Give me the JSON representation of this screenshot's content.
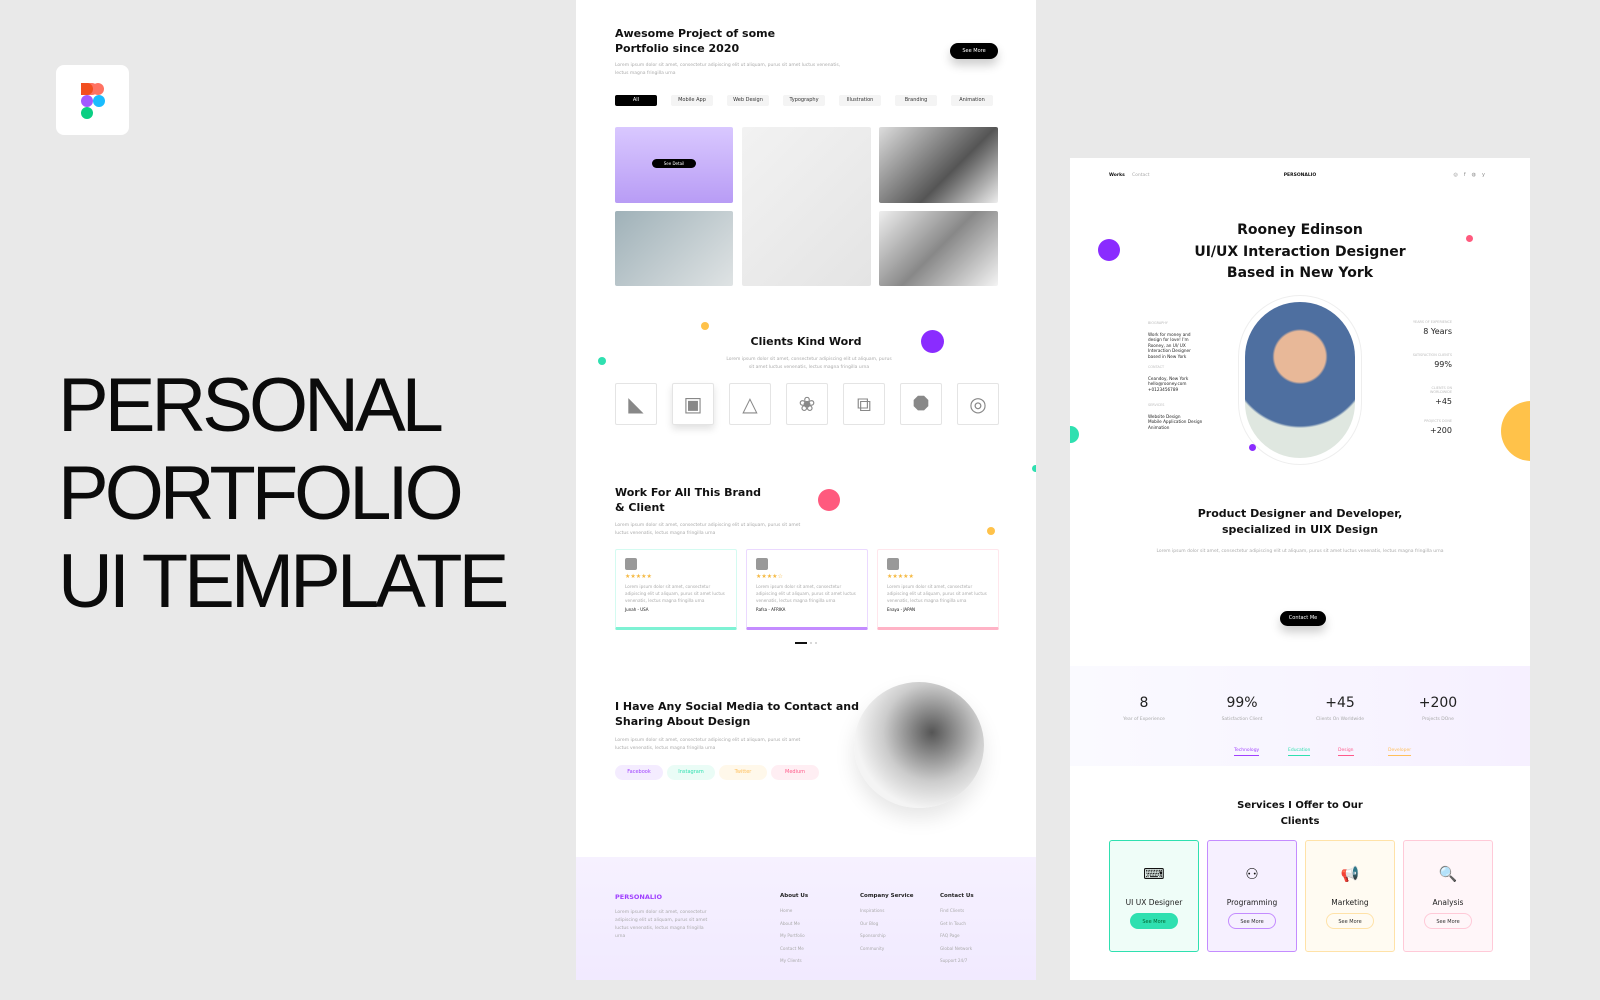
{
  "promo": {
    "title_lines": [
      "PERSONAL",
      "PORTFOLIO",
      "UI TEMPLATE"
    ],
    "logo": "figma-logo"
  },
  "lorem": "Lorem ipsum dolor sit amet, consectetur adipiscing elit ut aliquam, purus sit amet luctus venenatis, lectus magna fringilla urna",
  "portfolio": {
    "title_lines": [
      "Awesome Project of some",
      "Portfolio since 2020"
    ],
    "see_more": "See More",
    "see_detail": "See Detail",
    "tabs": [
      "All",
      "Mobile App",
      "Web Design",
      "Typography",
      "Illustration",
      "Branding",
      "Animation"
    ]
  },
  "clients": {
    "title": "Clients Kind Word"
  },
  "brand": {
    "title_lines": [
      "Work For All This Brand",
      "& Client"
    ],
    "testimonials": [
      {
        "stars": "★★★★★",
        "name": "Junah - USA",
        "color": "#7ef2d4"
      },
      {
        "stars": "★★★★☆",
        "name": "Rafsa - AFRIKA",
        "color": "#c48cff"
      },
      {
        "stars": "★★★★★",
        "name": "Enaya - JAPAN",
        "color": "#ffb3c6"
      }
    ]
  },
  "social": {
    "title_lines": [
      "I Have Any Social Media to Contact and",
      "Sharing About Design"
    ],
    "links": [
      {
        "label": "Facebook",
        "color": "#a040ff",
        "bg": "#f4ecff"
      },
      {
        "label": "Instagram",
        "color": "#2fe0b0",
        "bg": "#eafcf6"
      },
      {
        "label": "Twitter",
        "color": "#ffbf5a",
        "bg": "#fff8ea"
      },
      {
        "label": "Medium",
        "color": "#ff5a8a",
        "bg": "#ffeef3"
      }
    ]
  },
  "footer": {
    "brand": "PERSONALIO",
    "cols": [
      {
        "title": "About Us",
        "items": [
          "Home",
          "About Me",
          "My Portfolio",
          "Contact Me",
          "My Clients"
        ]
      },
      {
        "title": "Company Service",
        "items": [
          "Inspirations",
          "Our Blog",
          "Sponsorship",
          "Community"
        ]
      },
      {
        "title": "Contact Us",
        "items": [
          "Find Clients",
          "Get In Touch",
          "FAQ Page",
          "Global Network",
          "Support 24/7"
        ]
      }
    ]
  },
  "site": {
    "nav": [
      "Works",
      "Contact"
    ],
    "brand": "PERSONALIO",
    "social_icons": [
      "instagram-icon",
      "facebook-icon",
      "dribbble-icon",
      "twitter-icon"
    ],
    "hero_lines": [
      "Rooney Edinson",
      "UI/UX Interaction Designer",
      "Based in New York"
    ],
    "bio": {
      "k1": "BIOGRAPHY",
      "v1": "Work for money and design for love! I'm Rooney, an UI/ UX Interaction Designer based in New York",
      "k2": "CONTACT",
      "v2a": "Ceandoy, New York",
      "v2b": "hello@rooney.com",
      "v2c": "+0123456789",
      "k3": "SERVICES",
      "v3a": "Website Design",
      "v3b": "Mobile Application Design",
      "v3c": "Animation"
    },
    "side_stats": [
      {
        "k": "YEARS OF EXPERIENCE",
        "v": "8 Years"
      },
      {
        "k": "SATISFACTION CLIENTS",
        "v": "99%"
      },
      {
        "k": "CLIENTS ON WORLDWIDE",
        "v": "+45"
      },
      {
        "k": "PROJECTS DONE",
        "v": "+200"
      }
    ],
    "about_lines": [
      "Product Designer and Developer,",
      "specialized in UIX Design"
    ],
    "tags": [
      {
        "label": "Technology",
        "color": "#a040ff"
      },
      {
        "label": "Education",
        "color": "#2fe0b0"
      },
      {
        "label": "Design",
        "color": "#ff5a8a"
      },
      {
        "label": "Developer",
        "color": "#ffbf5a"
      }
    ],
    "contact_btn": "Contact Me",
    "stats": [
      {
        "v": "8",
        "l": "Year of Experience"
      },
      {
        "v": "99%",
        "l": "Satisfaction Client"
      },
      {
        "v": "+45",
        "l": "Clients On Worldwide"
      },
      {
        "v": "+200",
        "l": "Projects DOne"
      }
    ],
    "services_lines": [
      "Services I Offer to Our",
      "Clients"
    ],
    "services": [
      {
        "name": "UI UX Designer",
        "btn": "See More",
        "icon": "binary-code-icon",
        "color": "#2fe0b0",
        "bg": "#effdf8"
      },
      {
        "name": "Programming",
        "btn": "See More",
        "icon": "network-person-icon",
        "color": "#c48cff",
        "bg": "#f6f0ff"
      },
      {
        "name": "Marketing",
        "btn": "See More",
        "icon": "megaphone-icon",
        "color": "#ffe2a8",
        "bg": "#fffbf2"
      },
      {
        "name": "Analysis",
        "btn": "See More",
        "icon": "analysis-magnifier-icon",
        "color": "#ffcad8",
        "bg": "#fff6f9"
      }
    ]
  }
}
